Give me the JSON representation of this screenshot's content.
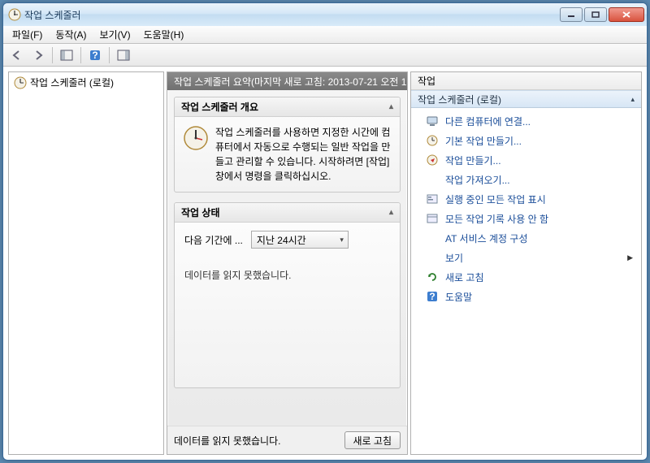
{
  "title": "작업 스케줄러",
  "menu": {
    "file": "파일(F)",
    "action": "동작(A)",
    "view": "보기(V)",
    "help": "도움말(H)"
  },
  "tree": {
    "root": "작업 스케줄러 (로컬)"
  },
  "main": {
    "header": "작업 스케줄러 요약(마지막 새로 고침: 2013-07-21 오전 1",
    "overview_title": "작업 스케줄러 개요",
    "overview_text": "작업 스케줄러를 사용하면 지정한 시간에 컴퓨터에서 자동으로 수행되는 일반 작업을 만들고 관리할 수 있습니다. 시작하려면 [작업] 창에서 명령을 클릭하십시오.",
    "state_title": "작업 상태",
    "state_period_label": "다음 기간에 ...",
    "state_period_value": "지난 24시간",
    "state_msg": "데이터를 읽지 못했습니다.",
    "footer_msg": "데이터를 읽지 못했습니다.",
    "refresh_btn": "새로 고침"
  },
  "actions": {
    "header": "작업",
    "group": "작업 스케줄러 (로컬)",
    "items": [
      {
        "label": "다른 컴퓨터에 연결..."
      },
      {
        "label": "기본 작업 만들기..."
      },
      {
        "label": "작업 만들기..."
      },
      {
        "label": "작업 가져오기..."
      },
      {
        "label": "실행 중인 모든 작업 표시"
      },
      {
        "label": "모든 작업 기록 사용 안 함"
      },
      {
        "label": "AT 서비스 계정 구성"
      },
      {
        "label": "보기",
        "submenu": true
      },
      {
        "label": "새로 고침"
      },
      {
        "label": "도움말"
      }
    ]
  }
}
